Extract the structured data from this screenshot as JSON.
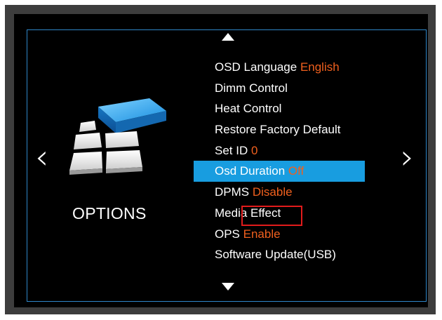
{
  "menu": {
    "items": [
      {
        "label": "OSD Language",
        "value": "English"
      },
      {
        "label": "Dimm Control",
        "value": ""
      },
      {
        "label": "Heat Control",
        "value": ""
      },
      {
        "label": "Restore Factory Default",
        "value": ""
      },
      {
        "label": "Set ID",
        "value": "0"
      },
      {
        "label": "Osd Duration",
        "value": "Off"
      },
      {
        "label": "DPMS",
        "value": "Disable"
      },
      {
        "label": "Media Effect",
        "value": ""
      },
      {
        "label": "OPS",
        "value": "Enable"
      },
      {
        "label": "Software Update(USB)",
        "value": ""
      }
    ],
    "selected_index": 5
  },
  "section": {
    "title": "OPTIONS",
    "icon": "options-blocks-icon"
  },
  "nav": {
    "left": "‹",
    "right": "›",
    "up_icon": "triangle-up-icon",
    "down_icon": "triangle-down-icon"
  },
  "colors": {
    "accent": "#189de0",
    "value": "#f0601e",
    "frame": "#2f87c9",
    "annotation": "#e21b1b"
  }
}
